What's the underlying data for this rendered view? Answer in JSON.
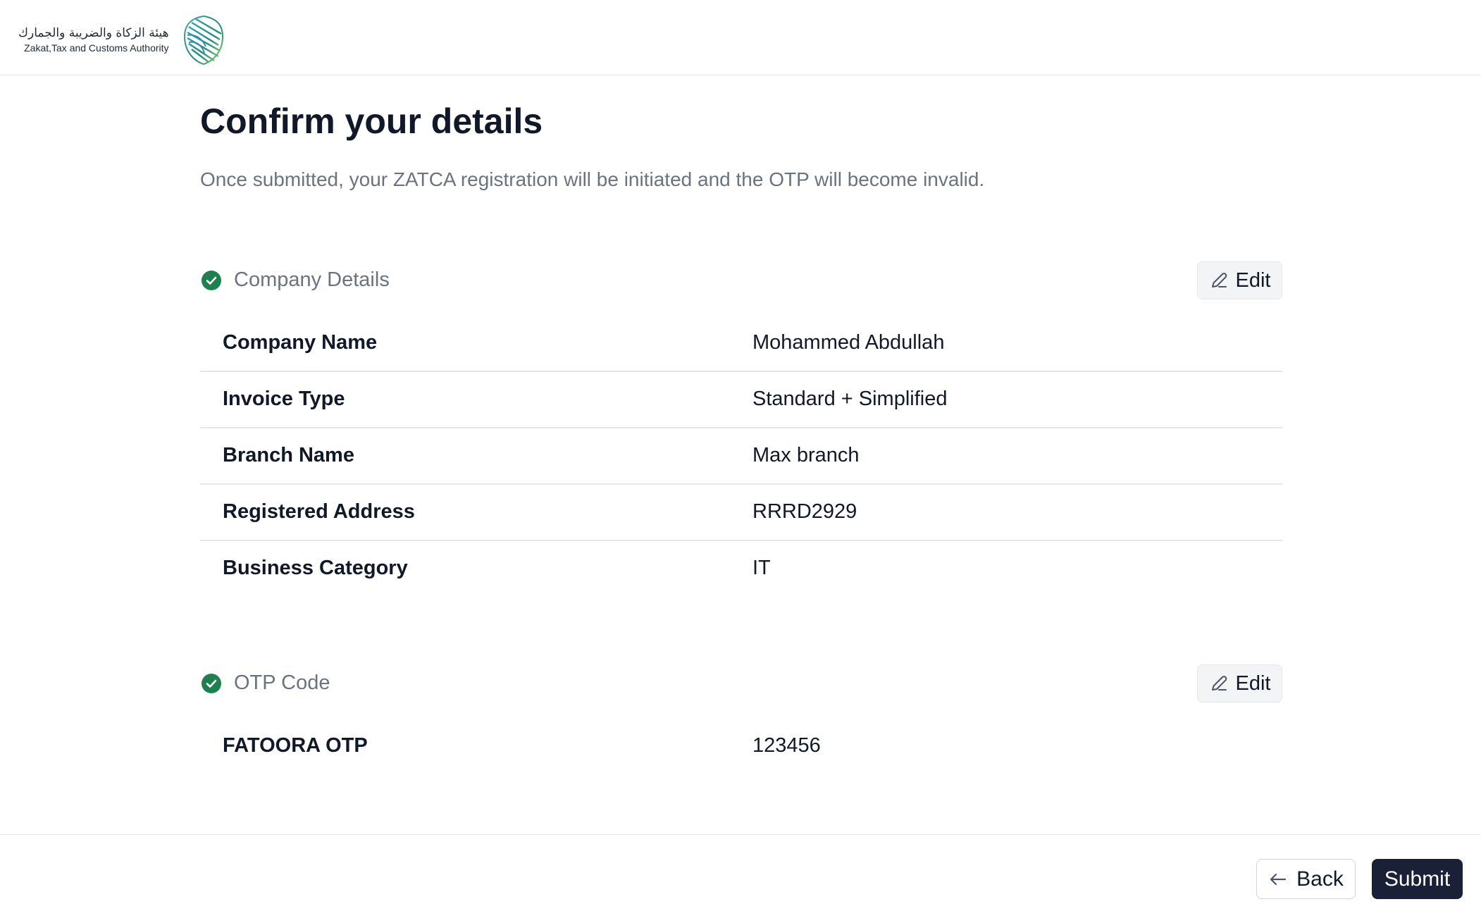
{
  "header": {
    "logo_arabic": "هيئة الزكاة والضريبة والجمارك",
    "logo_english": "Zakat,Tax and Customs Authority"
  },
  "page": {
    "title": "Confirm your details",
    "subtitle": "Once submitted, your ZATCA registration will be initiated and the OTP will become invalid."
  },
  "sections": [
    {
      "title": "Company Details",
      "edit_label": "Edit",
      "rows": [
        {
          "label": "Company Name",
          "value": "Mohammed Abdullah"
        },
        {
          "label": "Invoice Type",
          "value": "Standard + Simplified"
        },
        {
          "label": "Branch Name",
          "value": "Max branch"
        },
        {
          "label": "Registered Address",
          "value": "RRRD2929"
        },
        {
          "label": "Business Category",
          "value": "IT"
        }
      ]
    },
    {
      "title": "OTP Code",
      "edit_label": "Edit",
      "rows": [
        {
          "label": "FATOORA OTP",
          "value": "123456"
        }
      ]
    }
  ],
  "footer": {
    "back_label": "Back",
    "submit_label": "Submit"
  },
  "colors": {
    "check_green": "#1e7f4f",
    "submit_bg": "#1a2035",
    "muted_text": "#6b7280"
  },
  "icons": {
    "section_status": "check-circle-icon",
    "edit": "pencil-icon",
    "back": "arrow-left-icon"
  }
}
